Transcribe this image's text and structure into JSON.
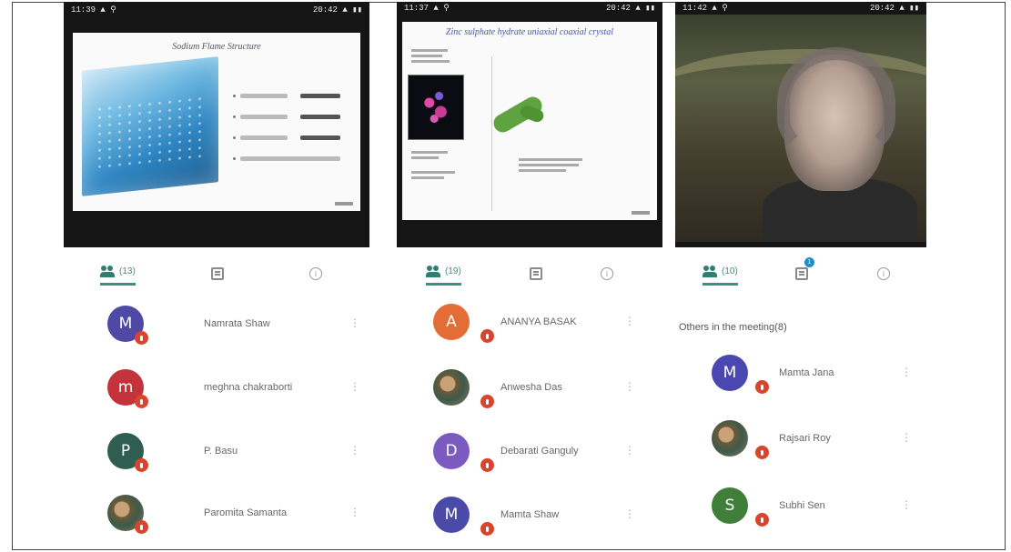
{
  "panels": [
    {
      "status_left": "11:39 ▲ ⚲",
      "status_right": "20:42 ▲ ▮▮",
      "slide_title": "Sodium Flame Structure",
      "tabs": [
        {
          "name": "participants",
          "count": "(13)",
          "active": true
        },
        {
          "name": "chat",
          "count": "",
          "active": false,
          "badge": ""
        },
        {
          "name": "info",
          "count": "",
          "active": false
        }
      ],
      "section_title": "",
      "participants": [
        {
          "initial": "M",
          "name": "Namrata Shaw",
          "color": "#4f49a6"
        },
        {
          "initial": "m",
          "name": "meghna chakraborti",
          "color": "#c2333c"
        },
        {
          "initial": "P",
          "name": "P. Basu",
          "color": "#2f5e51"
        },
        {
          "initial": "",
          "name": "Paromita Samanta",
          "color": "#6b5c3a",
          "photo": true
        }
      ]
    },
    {
      "status_left": "11:37 ▲ ⚲",
      "status_right": "20:42 ▲ ▮▮",
      "slide_title": "Zinc sulphate hydrate uniaxial coaxial crystal",
      "tabs": [
        {
          "name": "participants",
          "count": "(19)",
          "active": true
        },
        {
          "name": "chat",
          "count": "",
          "active": false,
          "badge": ""
        },
        {
          "name": "info",
          "count": "",
          "active": false
        }
      ],
      "section_title": "",
      "participants": [
        {
          "initial": "A",
          "name": "ANANYA BASAK",
          "color": "#e36d34"
        },
        {
          "initial": "",
          "name": "Anwesha Das",
          "color": "#5a6b7a",
          "photo": true
        },
        {
          "initial": "D",
          "name": "Debarati Ganguly",
          "color": "#7b5bc0"
        },
        {
          "initial": "M",
          "name": "Mamta Shaw",
          "color": "#4a4aa8"
        }
      ]
    },
    {
      "status_left": "11:42 ▲ ⚲",
      "status_right": "20:42 ▲ ▮▮",
      "slide_title": "",
      "tabs": [
        {
          "name": "participants",
          "count": "(10)",
          "active": true
        },
        {
          "name": "chat",
          "count": "",
          "active": false,
          "badge": "1"
        },
        {
          "name": "info",
          "count": "",
          "active": false
        }
      ],
      "section_title": "Others in the meeting(8)",
      "participants": [
        {
          "initial": "M",
          "name": "Mamta Jana",
          "color": "#4a48b0"
        },
        {
          "initial": "",
          "name": "Rajsari Roy",
          "color": "#4a5a3a",
          "photo": true
        },
        {
          "initial": "S",
          "name": "Subhi Sen",
          "color": "#3f7f3a"
        }
      ]
    }
  ]
}
